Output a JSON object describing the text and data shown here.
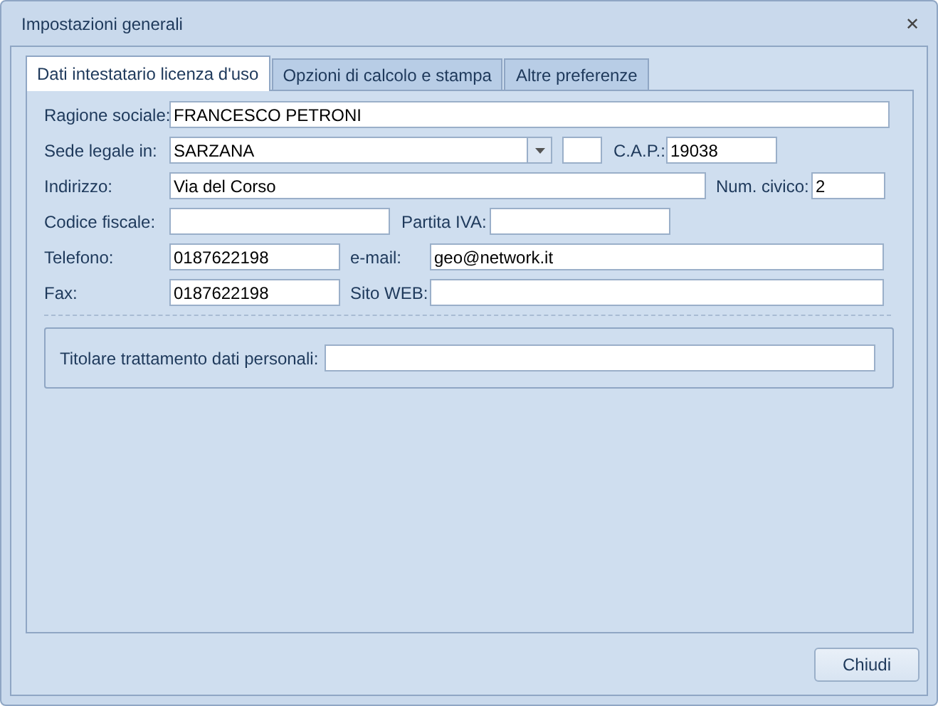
{
  "window": {
    "title": "Impostazioni generali",
    "close": "✕"
  },
  "tabs": [
    {
      "label": "Dati intestatario licenza d'uso",
      "selected": true
    },
    {
      "label": "Opzioni di calcolo e stampa",
      "selected": false
    },
    {
      "label": "Altre preferenze",
      "selected": false
    }
  ],
  "form": {
    "ragione_sociale": {
      "label": "Ragione sociale:",
      "value": "FRANCESCO PETRONI"
    },
    "sede_legale": {
      "label": "Sede legale in:",
      "value": "SARZANA"
    },
    "cap": {
      "label": "C.A.P.:",
      "value": "19038"
    },
    "indirizzo": {
      "label": "Indirizzo:",
      "value": "Via del Corso"
    },
    "num_civico": {
      "label": "Num. civico:",
      "value": "2"
    },
    "codice_fiscale": {
      "label": "Codice fiscale:"
    },
    "partita_iva": {
      "label": "Partita IVA:"
    },
    "telefono": {
      "label": "Telefono:",
      "value": "0187622198"
    },
    "email": {
      "label": "e-mail:",
      "value": "geo@network.it"
    },
    "fax": {
      "label": "Fax:",
      "value": "0187622198"
    },
    "sito_web": {
      "label": "Sito WEB:"
    },
    "titolare": {
      "label": "Titolare trattamento dati personali:"
    }
  },
  "buttons": [
    "Chiudi"
  ]
}
